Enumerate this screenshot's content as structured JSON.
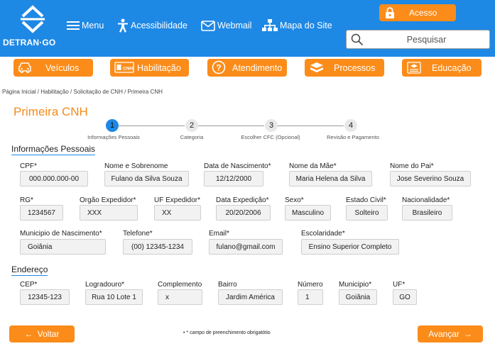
{
  "header": {
    "logo_text": "DETRAN·GO",
    "nav": [
      {
        "label": "Menu",
        "icon": "hamburger-icon"
      },
      {
        "label": "Acessibilidade",
        "icon": "accessibility-icon"
      },
      {
        "label": "Webmail",
        "icon": "mail-icon"
      },
      {
        "label": "Mapa do Site",
        "icon": "sitemap-icon"
      }
    ],
    "access_label": "Acesso",
    "search_placeholder": "Pesquisar"
  },
  "main_nav": [
    {
      "label": "Veículos",
      "icon": "car-icon"
    },
    {
      "label": "Habilitação",
      "icon": "cnh-icon"
    },
    {
      "label": "Atendimento",
      "icon": "question-icon"
    },
    {
      "label": "Processos",
      "icon": "folder-icon"
    },
    {
      "label": "Educação",
      "icon": "education-icon"
    }
  ],
  "breadcrumb": "Página Inicial  /  Habilitação  /  Solicitação de CNH / Primeira CNH",
  "page_title": "Primeira CNH",
  "steps": [
    {
      "number": "1",
      "label": "Informações Pessoais",
      "active": true
    },
    {
      "number": "2",
      "label": "Categoria",
      "active": false
    },
    {
      "number": "3",
      "label": "Escolher CFC (Opcional)",
      "active": false
    },
    {
      "number": "4",
      "label": "Revisão e Pagamento",
      "active": false
    }
  ],
  "personal": {
    "title": "Informações Pessoais",
    "fields": [
      {
        "label": "CPF*",
        "value": "000.000.000-00"
      },
      {
        "label": "Nome e Sobrenome",
        "value": "Fulano da Silva Souza"
      },
      {
        "label": "Data de Nascimento*",
        "value": "12/12/2000"
      },
      {
        "label": "Nome da Mãe*",
        "value": "Maria Helena da Silva"
      },
      {
        "label": "Nome do Pai*",
        "value": "Jose Severino Souza"
      },
      {
        "label": "RG*",
        "value": "1234567"
      },
      {
        "label": "Orgão Expedidor*",
        "value": "XXX"
      },
      {
        "label": "UF Expedidor*",
        "value": "XX"
      },
      {
        "label": "Data Expedição*",
        "value": "20/20/2006"
      },
      {
        "label": "Sexo*",
        "value": "Masculino"
      },
      {
        "label": "Estado Civil*",
        "value": "Solteiro"
      },
      {
        "label": "Nacionalidade*",
        "value": "Brasileiro"
      },
      {
        "label": "Municipio de Nascimento*",
        "value": "Goiânia"
      },
      {
        "label": "Telefone*",
        "value": "(00) 12345-1234"
      },
      {
        "label": "Email*",
        "value": "fulano@gmail.com"
      },
      {
        "label": "Escolaridade*",
        "value": "Ensino Superior Completo"
      }
    ]
  },
  "address": {
    "title": "Endereço",
    "fields": [
      {
        "label": "CEP*",
        "value": "12345-123"
      },
      {
        "label": "Logradouro*",
        "value": "Rua 10 Lote 1"
      },
      {
        "label": "Complemento",
        "value": "x"
      },
      {
        "label": "Bairro",
        "value": "Jardim América"
      },
      {
        "label": "Número",
        "value": "1"
      },
      {
        "label": "Municipio*",
        "value": "Goiânia"
      },
      {
        "label": "UF*",
        "value": "GO"
      }
    ]
  },
  "footer": {
    "back_label": "Voltar",
    "next_label": "Avançar",
    "required_note": "• * campo de preenchimento obrigatótio"
  },
  "colors": {
    "primary": "#1e88e5",
    "accent": "#fb8c1a",
    "title": "#f28b1c"
  }
}
